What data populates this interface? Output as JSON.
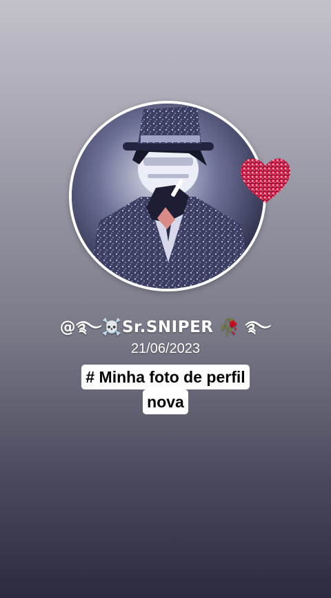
{
  "story": {
    "username": "@࿐☠️Sr.SNIPER 🥀 ࿐",
    "date": "21/06/2023",
    "caption_lines": [
      "# Minha foto de perfil",
      "nova"
    ]
  },
  "avatar": {
    "icon": "profile-picture-masked-character-in-top-hat",
    "sticker": "glitter-heart-icon"
  },
  "colors": {
    "frame": "#ffffff",
    "heart": "#d81b4a",
    "caption_bg": "#ffffff",
    "caption_text": "#000000"
  }
}
